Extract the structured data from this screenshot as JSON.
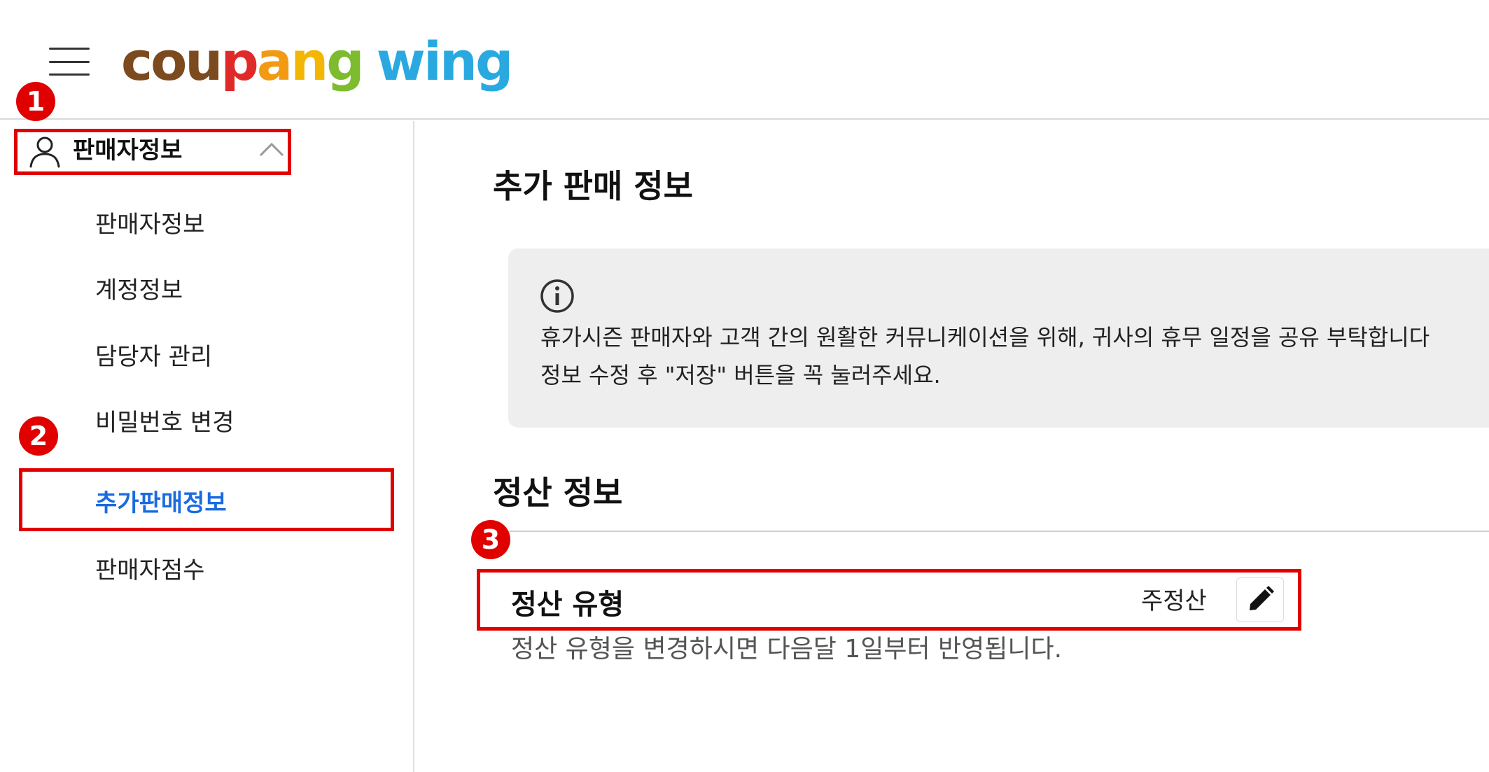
{
  "header": {
    "logo": [
      {
        "ch": "c",
        "color": "#7b4a1e"
      },
      {
        "ch": "o",
        "color": "#7b4a1e"
      },
      {
        "ch": "u",
        "color": "#7b4a1e"
      },
      {
        "ch": "p",
        "color": "#e02a2a"
      },
      {
        "ch": "a",
        "color": "#f29a12"
      },
      {
        "ch": "n",
        "color": "#f2b705"
      },
      {
        "ch": "g",
        "color": "#7dbb2f"
      },
      {
        "ch": " ",
        "color": "#ffffff"
      },
      {
        "ch": "w",
        "color": "#2aa9e0"
      },
      {
        "ch": "i",
        "color": "#2aa9e0"
      },
      {
        "ch": "n",
        "color": "#2aa9e0"
      },
      {
        "ch": "g",
        "color": "#2aa9e0"
      }
    ]
  },
  "annotations": {
    "marker1": "1",
    "marker2": "2",
    "marker3": "3",
    "highlight_color": "#e00000"
  },
  "sidebar": {
    "group_title": "판매자정보",
    "group_icon": "user-icon",
    "items": [
      {
        "label": "판매자정보",
        "active": false
      },
      {
        "label": "계정정보",
        "active": false
      },
      {
        "label": "담당자 관리",
        "active": false
      },
      {
        "label": "비밀번호 변경",
        "active": false
      },
      {
        "label": "추가판매정보",
        "active": true
      },
      {
        "label": "판매자점수",
        "active": false
      }
    ],
    "active_color": "#1a6be0"
  },
  "main": {
    "title": "추가 판매 정보",
    "notice": {
      "icon": "info-icon",
      "line1": "휴가시즌 판매자와 고객 간의 원활한 커뮤니케이션을 위해, 귀사의 휴무 일정을 공유 부탁합니다",
      "line2": "정보 수정 후 \"저장\" 버튼을 꼭 눌러주세요."
    },
    "settlement": {
      "section_title": "정산 정보",
      "row_label": "정산 유형",
      "row_value": "주정산",
      "edit_icon": "pencil-icon",
      "help": "정산 유형을 변경하시면 다음달 1일부터 반영됩니다."
    }
  }
}
